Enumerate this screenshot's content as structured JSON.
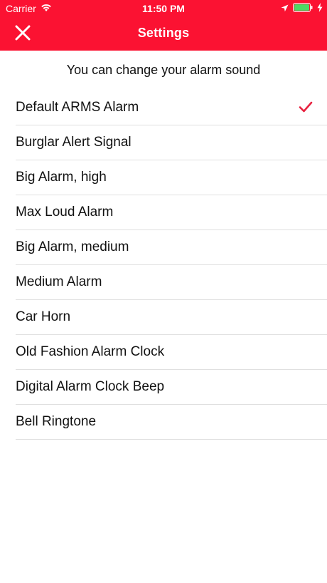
{
  "status_bar": {
    "carrier": "Carrier",
    "time": "11:50 PM",
    "icons": [
      "wifi-icon",
      "location-icon",
      "battery-icon",
      "charging-icon"
    ]
  },
  "header": {
    "title": "Settings",
    "close_icon": "close-icon",
    "background_color": "#fb1232"
  },
  "subtitle": "You can change your alarm sound",
  "alarm_sounds": {
    "selected_index": 0,
    "accent_color": "#e8213f",
    "items": [
      {
        "label": "Default ARMS Alarm"
      },
      {
        "label": "Burglar Alert Signal"
      },
      {
        "label": "Big Alarm, high"
      },
      {
        "label": "Max Loud Alarm"
      },
      {
        "label": "Big Alarm, medium"
      },
      {
        "label": "Medium Alarm"
      },
      {
        "label": "Car Horn"
      },
      {
        "label": "Old Fashion Alarm Clock"
      },
      {
        "label": "Digital Alarm Clock Beep"
      },
      {
        "label": "Bell Ringtone"
      }
    ]
  }
}
